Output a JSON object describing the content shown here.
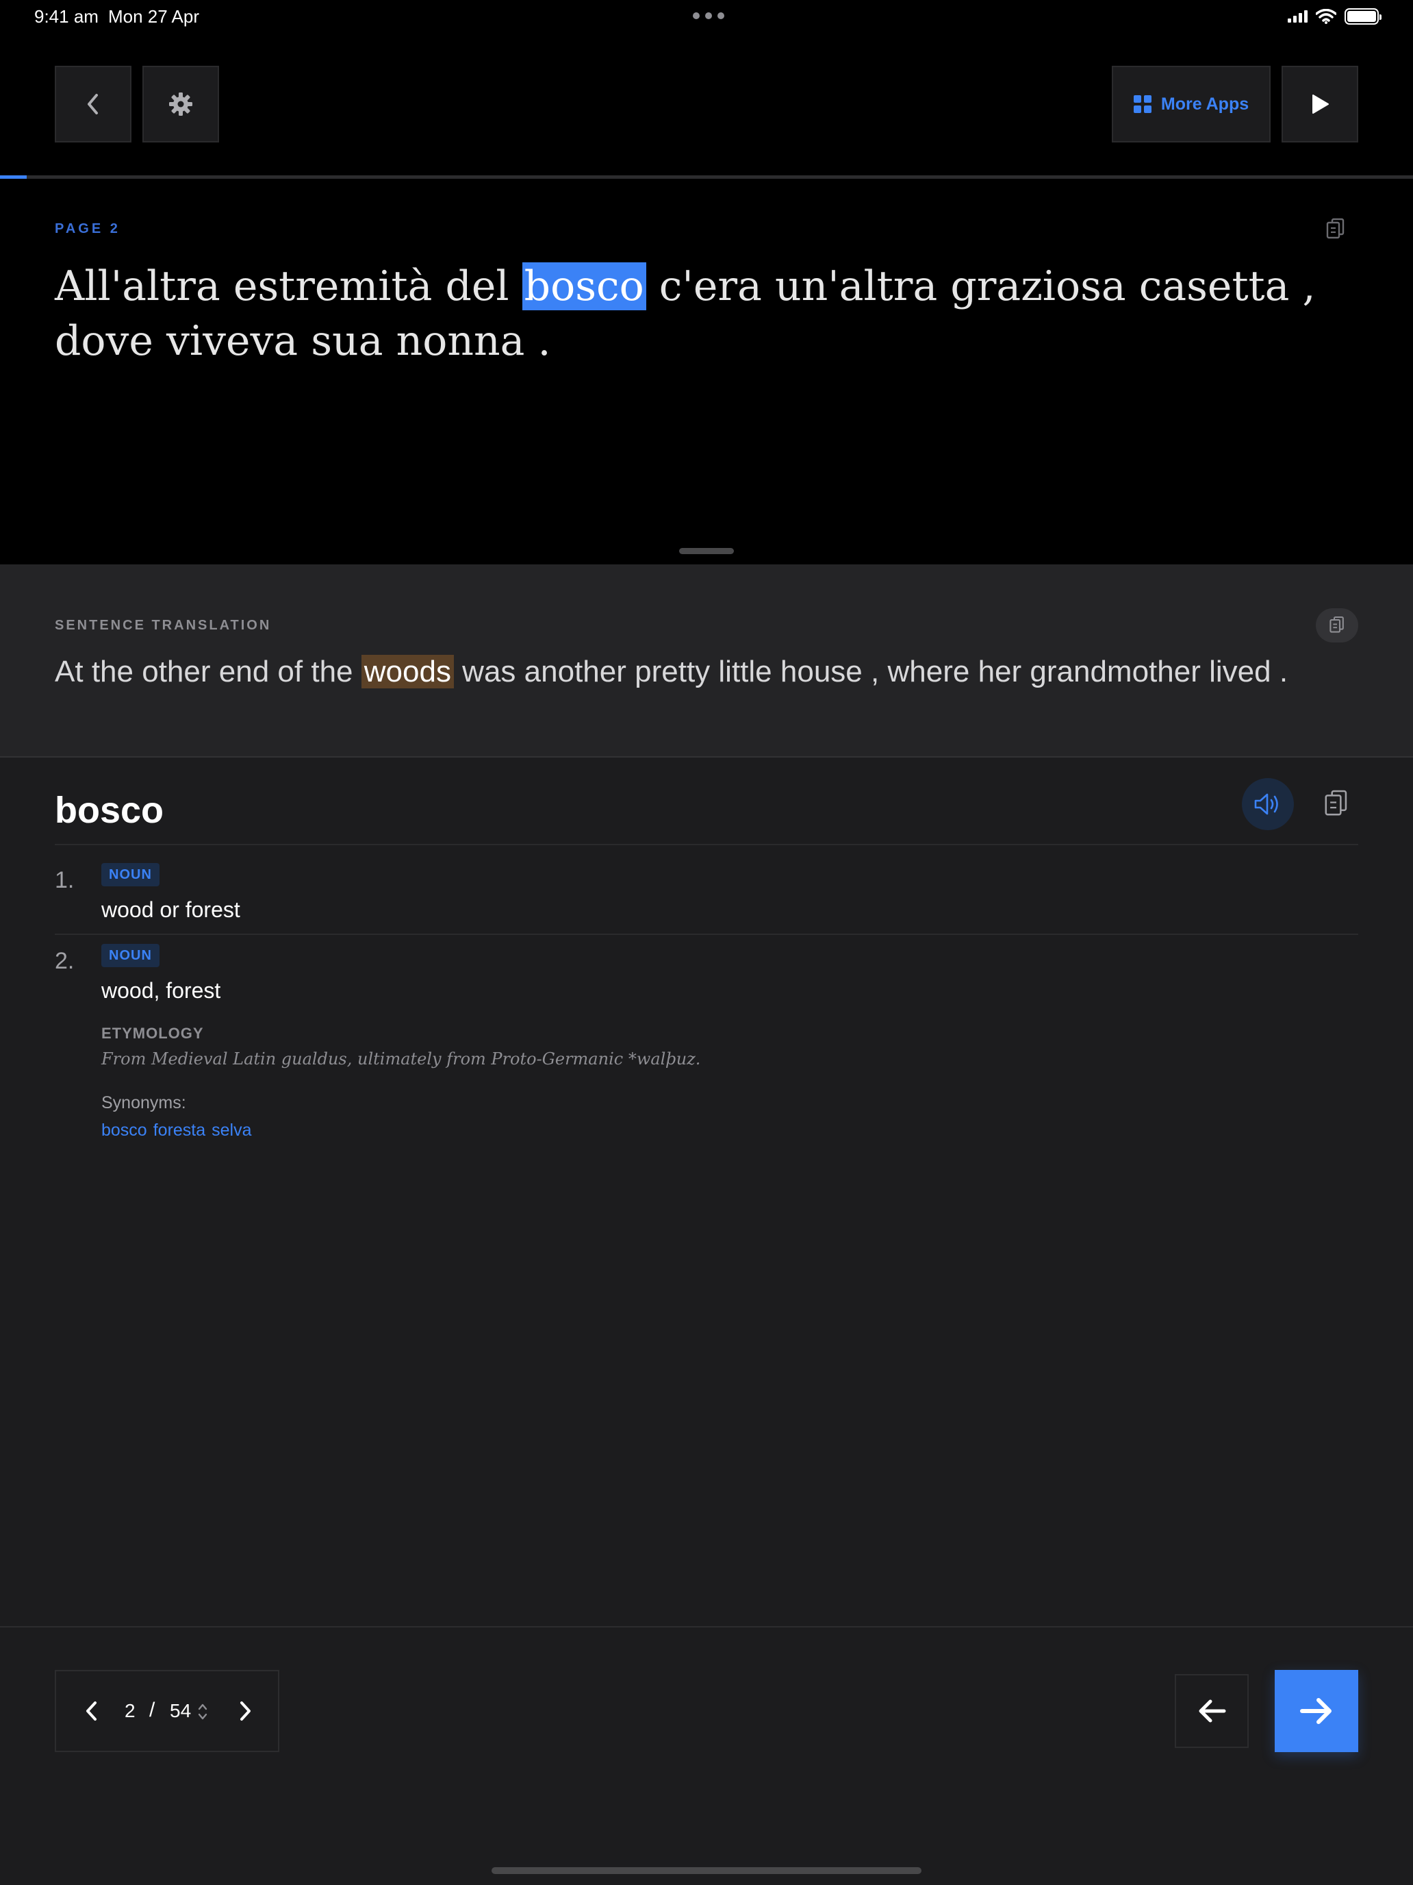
{
  "status_bar": {
    "time": "9:41 am",
    "date": "Mon 27 Apr",
    "multitasking_icon": "ellipsis-icon",
    "cellular_icon": "cellular-signal-icon",
    "wifi_icon": "wifi-icon",
    "battery_icon": "battery-icon",
    "battery_level": 1.0
  },
  "toolbar": {
    "back_icon": "chevron-left-icon",
    "settings_icon": "gear-icon",
    "more_apps_icon": "grid-icon",
    "more_apps_label": "More Apps",
    "play_icon": "play-icon"
  },
  "reading_progress": 0.019,
  "reader": {
    "page_label": "PAGE 2",
    "copy_icon": "copy-icon",
    "sentence_words": [
      "All'altra",
      "estremità",
      "del",
      "bosco",
      "c'era",
      "un'altra",
      "graziosa",
      "casetta",
      ",",
      "dove",
      "viveva",
      "sua",
      "nonna",
      "."
    ],
    "highlighted_word": "bosco"
  },
  "translation": {
    "label": "SENTENCE TRANSLATION",
    "copy_icon": "copy-icon",
    "words": [
      "At",
      "the",
      "other",
      "end",
      "of",
      "the",
      "woods",
      "was",
      "another",
      "pretty",
      "little",
      "house",
      ",",
      "where",
      "her",
      "grandmother",
      "lived",
      "."
    ],
    "highlighted_word": "woods"
  },
  "dictionary": {
    "word": "bosco",
    "speaker_icon": "speaker-icon",
    "copy_icon": "copy-icon",
    "definitions": [
      {
        "number": "1.",
        "pos": "NOUN",
        "text": "wood or forest"
      },
      {
        "number": "2.",
        "pos": "NOUN",
        "text": "wood, forest"
      }
    ],
    "etymology_label": "ETYMOLOGY",
    "etymology_text": "From Medieval Latin gualdus, ultimately from Proto-Germanic *walþuz.",
    "synonyms_label": "Synonyms:",
    "synonyms": [
      "bosco",
      "foresta",
      "selva"
    ]
  },
  "pager": {
    "current": "2",
    "separator": "/",
    "total": "54",
    "prev_icon": "chevron-left-icon",
    "next_icon": "chevron-right-icon",
    "stepper_icon": "chevron-up-down-icon"
  },
  "navigation": {
    "back_icon": "arrow-left-icon",
    "next_icon": "arrow-right-icon"
  },
  "colors": {
    "accent": "#3b82f6",
    "highlight_translation": "#5b4127",
    "background": "#1c1c1e",
    "top_background": "#000000"
  }
}
